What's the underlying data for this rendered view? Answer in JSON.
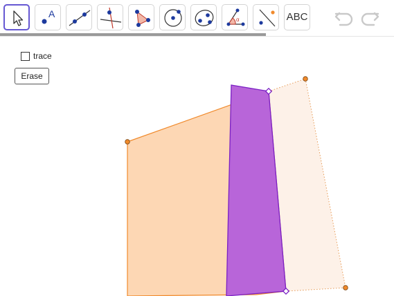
{
  "toolbar": {
    "tools": [
      {
        "name": "move-tool",
        "active": true
      },
      {
        "name": "point-tool"
      },
      {
        "name": "line-tool"
      },
      {
        "name": "perpendicular-line-tool"
      },
      {
        "name": "polygon-tool"
      },
      {
        "name": "circle-tool"
      },
      {
        "name": "conic-tool"
      },
      {
        "name": "angle-tool"
      },
      {
        "name": "reflect-tool"
      },
      {
        "name": "text-tool",
        "label": "ABC"
      }
    ],
    "undo_icon": "undo-icon",
    "redo_icon": "redo-icon"
  },
  "controls": {
    "trace_label": "trace",
    "trace_checked": false,
    "erase_label": "Erase"
  },
  "colors": {
    "orange_fill": "#fdd7b4",
    "orange_stroke": "#f08a2c",
    "purple_fill": "#b865d9",
    "purple_stroke": "#7a1fc4",
    "accent": "#6557d2",
    "point_blue": "#1d3a9e"
  }
}
